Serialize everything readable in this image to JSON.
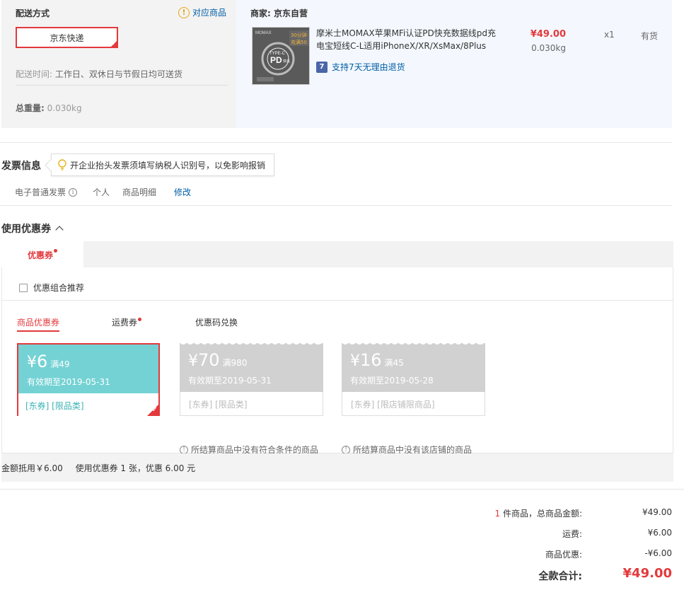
{
  "shipping": {
    "title": "配送方式",
    "match_link": "对应商品",
    "option": "京东快递",
    "time_label": "配送时间:",
    "time_value": "工作日、双休日与节假日均可送货",
    "weight_label": "总重量:",
    "weight_value": "0.030kg"
  },
  "seller": {
    "label": "商家: 京东自营",
    "product": {
      "name": "摩米士MOMAX苹果MFi认证PD快充数据线pd充电宝短线C-L适用iPhoneX/XR/XsMax/8Plus",
      "return_badge": "7",
      "return_text": "支持7天无理由退货",
      "price": "¥49.00",
      "weight": "0.030kg",
      "qty": "x1",
      "stock": "有货",
      "image_texts": {
        "brand": "MOMAX",
        "promo1": "30分钟",
        "promo2": "充满50",
        "typec": "TYPE-C",
        "pd": "PD",
        "fast": "快充"
      }
    }
  },
  "invoice": {
    "title": "发票信息",
    "tip": "开企业抬头发票须填写纳税人识别号，以免影响报销",
    "type": "电子普通发票",
    "title_type": "个人",
    "content": "商品明细",
    "edit": "修改"
  },
  "coupons": {
    "title": "使用优惠券",
    "tab": "优惠券",
    "combo_label": "优惠组合推荐",
    "sub_tabs": [
      "商品优惠券",
      "运费券",
      "优惠码兑换"
    ],
    "items": [
      {
        "currency": "¥",
        "amount": "6",
        "condition": "满49",
        "expiry": "有效期至2019-05-31",
        "tags": "[东券]  [限品类]",
        "selected": true
      },
      {
        "currency": "¥",
        "amount": "70",
        "condition": "满980",
        "expiry": "有效期至2019-05-31",
        "tags": "[东券]  [限品类]",
        "note": "所结算商品中没有符合条件的商品"
      },
      {
        "currency": "¥",
        "amount": "16",
        "condition": "满45",
        "expiry": "有效期至2019-05-28",
        "tags": "[东券]  [限店铺限商品]",
        "note": "所结算商品中没有该店铺的商品"
      }
    ],
    "summary_amount": "金额抵用￥6.00",
    "summary_count": "使用优惠券 1 张，优惠 6.00 元"
  },
  "totals": {
    "count": "1",
    "items_label": "件商品，总商品金额:",
    "items_value": "¥49.00",
    "freight_label": "运费:",
    "freight_value": "¥6.00",
    "discount_label": "商品优惠:",
    "discount_value": "-¥6.00",
    "grand_label": "全款合计:",
    "grand_value": "¥49.00"
  },
  "colors": {
    "accent": "#e4393c",
    "link": "#005ea7",
    "coupon_active": "#74d2d4",
    "coupon_disabled": "#d1d1d1"
  }
}
